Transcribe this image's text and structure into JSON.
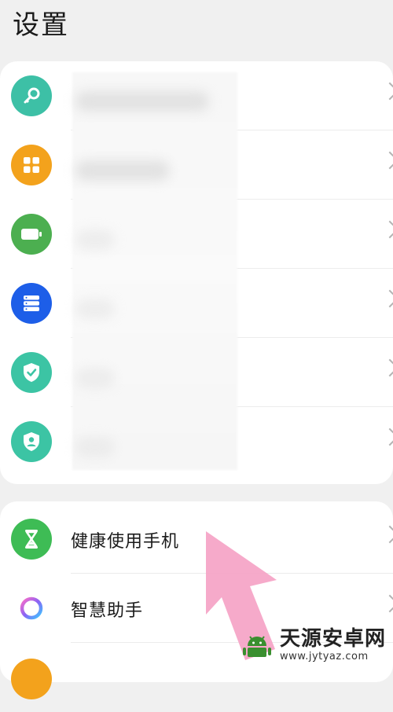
{
  "header": {
    "title": "设置"
  },
  "group1": {
    "items": [
      {
        "icon": "key-icon",
        "color": "#3dc0a6",
        "label": ""
      },
      {
        "icon": "apps-grid-icon",
        "color": "#f3a21c",
        "label": ""
      },
      {
        "icon": "battery-icon",
        "color": "#4caf50",
        "label": ""
      },
      {
        "icon": "storage-icon",
        "color": "#1d5ee8",
        "label": ""
      },
      {
        "icon": "shield-check-icon",
        "color": "#3cc4a4",
        "label": ""
      },
      {
        "icon": "shield-user-icon",
        "color": "#3cc4a4",
        "label": ""
      }
    ]
  },
  "group2": {
    "items": [
      {
        "icon": "hourglass-icon",
        "color": "#3ebc55",
        "label": "健康使用手机"
      },
      {
        "icon": "assistant-ring-icon",
        "color": "#a86bf0",
        "label": "智慧助手"
      }
    ]
  },
  "watermark": {
    "name": "天源安卓网",
    "url": "www.jytyaz.com"
  },
  "colors": {
    "annotation_arrow": "#f5a3c6"
  }
}
